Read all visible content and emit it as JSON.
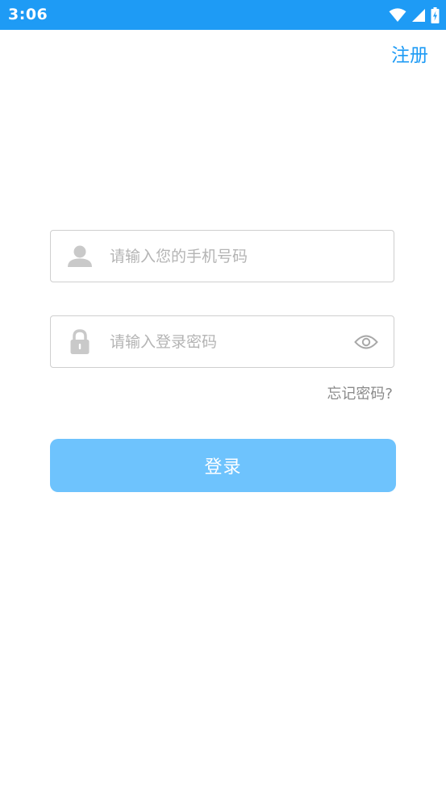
{
  "status_bar": {
    "time": "3:06",
    "background_color": "#1e9bf5",
    "icons": [
      "wifi-icon",
      "cell-signal-icon",
      "battery-charging-icon"
    ]
  },
  "header": {
    "register_label": "注册",
    "accent_color": "#1e9bf5"
  },
  "form": {
    "phone": {
      "placeholder": "请输入您的手机号码",
      "value": "",
      "icon": "user-icon"
    },
    "password": {
      "placeholder": "请输入登录密码",
      "value": "",
      "icon": "lock-icon",
      "toggle_icon": "eye-icon"
    },
    "forgot_label": "忘记密码?",
    "login_label": "登录",
    "login_button_color": "#6ec3fd"
  }
}
